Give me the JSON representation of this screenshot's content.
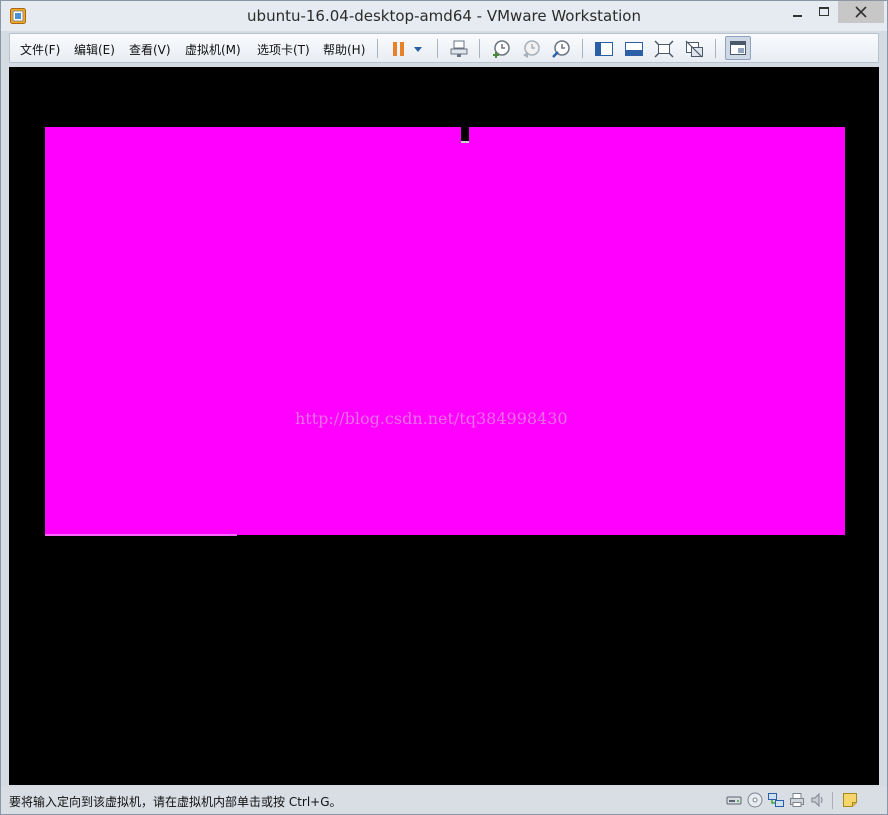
{
  "window": {
    "title": "ubuntu-16.04-desktop-amd64 - VMware Workstation"
  },
  "menu": {
    "items": [
      {
        "label": "文件(F)"
      },
      {
        "label": "编辑(E)"
      },
      {
        "label": "查看(V)"
      },
      {
        "label": "虚拟机(M)"
      },
      {
        "label": "选项卡(T)"
      },
      {
        "label": "帮助(H)"
      }
    ]
  },
  "toolbar": {
    "icons": [
      "pause-icon",
      "dropdown-arrow-icon",
      "send-ctrl-alt-del-icon",
      "snapshot-take-icon",
      "snapshot-revert-icon",
      "snapshot-manager-icon",
      "show-sidebar-icon",
      "show-thumbnail-bar-icon",
      "full-screen-icon",
      "unity-icon",
      "console-view-icon"
    ]
  },
  "console": {
    "watermark": "http://blog.csdn.net/tq384998430",
    "screen_color": "#ff00ff"
  },
  "statusbar": {
    "message": "要将输入定向到该虚拟机，请在虚拟机内部单击或按 Ctrl+G。",
    "icons": [
      "hard-disk-icon",
      "cd-dvd-icon",
      "network-adapter-icon",
      "printer-icon",
      "sound-card-icon",
      "message-log-icon"
    ]
  },
  "colors": {
    "accent": "#ff00ff",
    "console_background": "#000000",
    "pause_orange": "#e8822a"
  }
}
